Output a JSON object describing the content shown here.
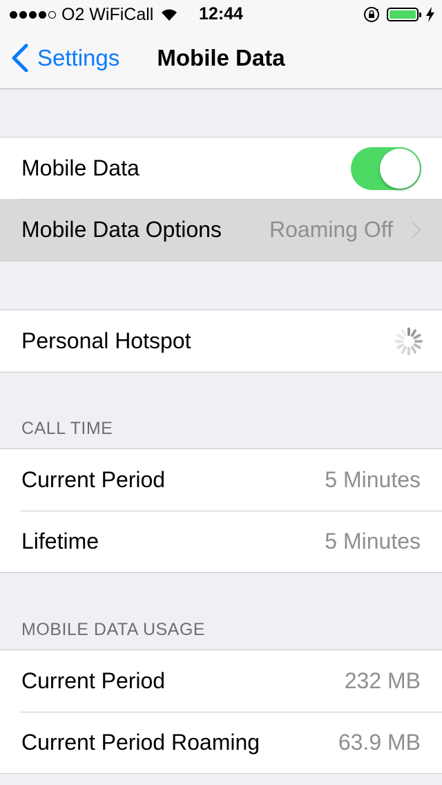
{
  "status_bar": {
    "carrier": "O2 WiFiCall",
    "time": "12:44",
    "signal_bars_filled": 4,
    "signal_bars_total": 5,
    "battery_color": "#4cd964"
  },
  "nav": {
    "back_label": "Settings",
    "title": "Mobile Data",
    "accent": "#0a7aff"
  },
  "mobile_data": {
    "label": "Mobile Data",
    "enabled": true,
    "toggle_on_color": "#4cd964"
  },
  "options": {
    "label": "Mobile Data Options",
    "value": "Roaming Off"
  },
  "hotspot": {
    "label": "Personal Hotspot"
  },
  "call_time": {
    "header": "CALL TIME",
    "rows": [
      {
        "label": "Current Period",
        "value": "5 Minutes"
      },
      {
        "label": "Lifetime",
        "value": "5 Minutes"
      }
    ]
  },
  "usage": {
    "header": "MOBILE DATA USAGE",
    "rows": [
      {
        "label": "Current Period",
        "value": "232 MB"
      },
      {
        "label": "Current Period Roaming",
        "value": "63.9 MB"
      }
    ]
  }
}
